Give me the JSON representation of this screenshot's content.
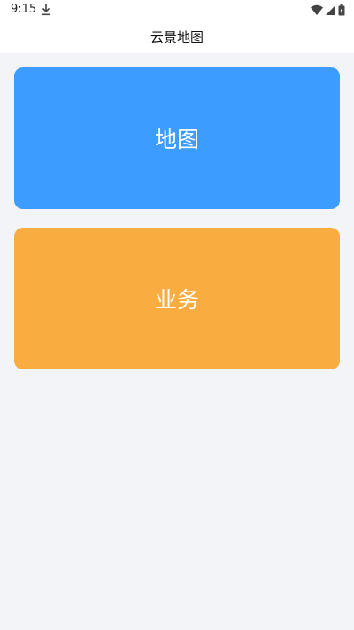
{
  "status_bar": {
    "time": "9:15",
    "icons": [
      "download-icon",
      "wifi-icon",
      "signal-icon",
      "battery-icon"
    ]
  },
  "header": {
    "title": "云景地图"
  },
  "cards": [
    {
      "label": "地图",
      "color": "#3d9cff"
    },
    {
      "label": "业务",
      "color": "#f9ac40"
    }
  ]
}
